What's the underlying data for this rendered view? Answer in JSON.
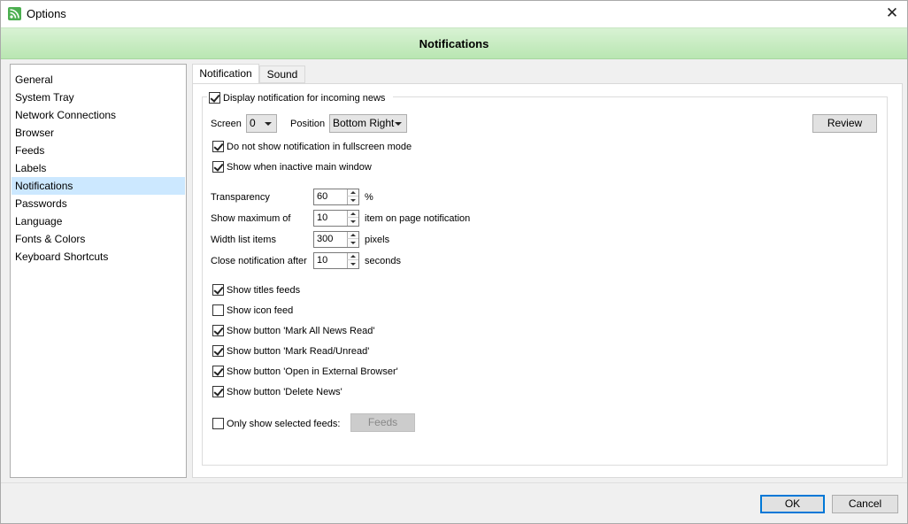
{
  "window": {
    "title": "Options",
    "close_glyph": "✕",
    "icon": "rss-icon"
  },
  "header": {
    "title": "Notifications"
  },
  "sidebar": {
    "items": [
      {
        "label": "General"
      },
      {
        "label": "System Tray"
      },
      {
        "label": "Network Connections"
      },
      {
        "label": "Browser"
      },
      {
        "label": "Feeds"
      },
      {
        "label": "Labels"
      },
      {
        "label": "Notifications",
        "selected": true
      },
      {
        "label": "Passwords"
      },
      {
        "label": "Language"
      },
      {
        "label": "Fonts & Colors"
      },
      {
        "label": "Keyboard Shortcuts"
      }
    ]
  },
  "tabs": [
    {
      "label": "Notification",
      "active": true
    },
    {
      "label": "Sound",
      "active": false
    }
  ],
  "notification": {
    "display_group": {
      "label": "Display notification for incoming news",
      "checked": true
    },
    "screen_label": "Screen",
    "screen_value": "0",
    "position_label": "Position",
    "position_value": "Bottom Right",
    "review_button": "Review",
    "no_fullscreen": {
      "label": "Do not show notification in fullscreen mode",
      "checked": true
    },
    "show_inactive": {
      "label": "Show when inactive main window",
      "checked": true
    },
    "transparency": {
      "label": "Transparency",
      "value": "60",
      "unit": "%"
    },
    "show_max": {
      "label": "Show maximum of",
      "value": "10",
      "unit": "item on page notification"
    },
    "width_list": {
      "label": "Width list items",
      "value": "300",
      "unit": "pixels"
    },
    "close_after": {
      "label": "Close notification after",
      "value": "10",
      "unit": "seconds"
    },
    "options": [
      {
        "label": "Show titles feeds",
        "checked": true
      },
      {
        "label": "Show icon feed",
        "checked": false
      },
      {
        "label": "Show button 'Mark All News Read'",
        "checked": true
      },
      {
        "label": "Show button 'Mark Read/Unread'",
        "checked": true
      },
      {
        "label": "Show button 'Open in External Browser'",
        "checked": true
      },
      {
        "label": "Show button 'Delete News'",
        "checked": true
      }
    ],
    "only_selected": {
      "label": "Only show selected feeds:",
      "checked": false
    },
    "feeds_button": "Feeds"
  },
  "footer": {
    "ok": "OK",
    "cancel": "Cancel"
  }
}
